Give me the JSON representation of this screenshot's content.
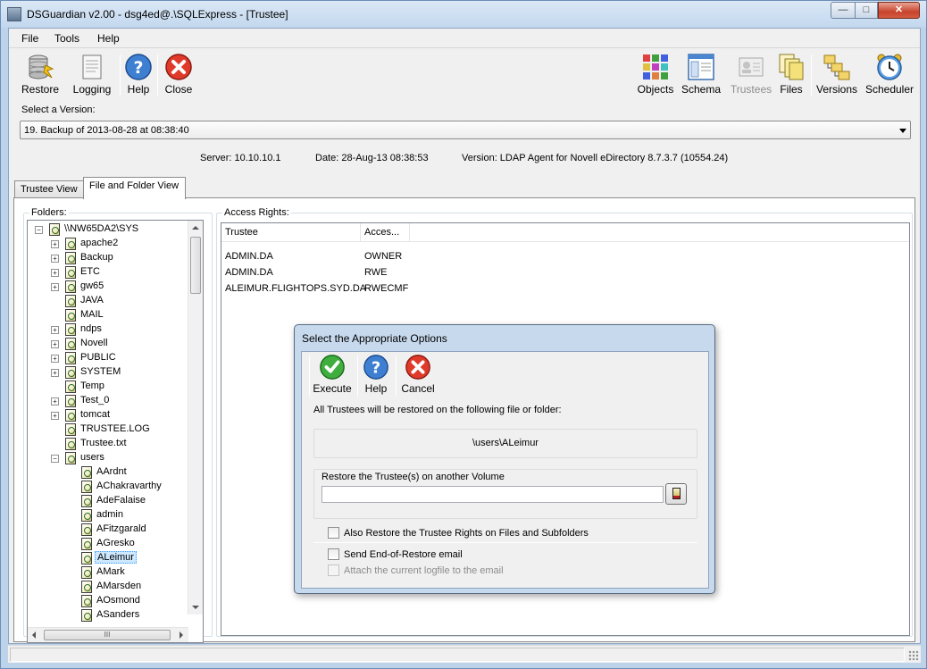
{
  "window": {
    "title": "DSGuardian v2.00 - dsg4ed@.\\SQLExpress - [Trustee]"
  },
  "menu": {
    "file": "File",
    "tools": "Tools",
    "help": "Help"
  },
  "toolbar": {
    "restore": "Restore",
    "logging": "Logging",
    "help": "Help",
    "close": "Close",
    "objects": "Objects",
    "schema": "Schema",
    "trustees": "Trustees",
    "files": "Files",
    "versions": "Versions",
    "scheduler": "Scheduler"
  },
  "version": {
    "label": "Select a Version:",
    "selected": "19. Backup of 2013-08-28 at 08:38:40"
  },
  "info": {
    "server": "Server: 10.10.10.1",
    "date": "Date: 28-Aug-13 08:38:53",
    "version": "Version: LDAP Agent for Novell eDirectory 8.7.3.7 (10554.24)"
  },
  "tabs": [
    {
      "label": "Trustee View",
      "active": false
    },
    {
      "label": "File and Folder View",
      "active": true
    }
  ],
  "folders": {
    "title": "Folders:",
    "root": "\\\\NW65DA2\\SYS",
    "items": [
      {
        "label": "apache2",
        "expandable": true
      },
      {
        "label": "Backup",
        "expandable": true
      },
      {
        "label": "ETC",
        "expandable": true
      },
      {
        "label": "gw65",
        "expandable": true
      },
      {
        "label": "JAVA",
        "expandable": false
      },
      {
        "label": "MAIL",
        "expandable": false
      },
      {
        "label": "ndps",
        "expandable": true
      },
      {
        "label": "Novell",
        "expandable": true
      },
      {
        "label": "PUBLIC",
        "expandable": true
      },
      {
        "label": "SYSTEM",
        "expandable": true
      },
      {
        "label": "Temp",
        "expandable": false
      },
      {
        "label": "Test_0",
        "expandable": true
      },
      {
        "label": "tomcat",
        "expandable": true
      },
      {
        "label": "TRUSTEE.LOG",
        "expandable": false
      },
      {
        "label": "Trustee.txt",
        "expandable": false
      },
      {
        "label": "users",
        "expandable": true,
        "expanded": true
      }
    ],
    "users": [
      "AArdnt",
      "AChakravarthy",
      "AdeFalaise",
      "admin",
      "AFitzgarald",
      "AGresko",
      "ALeimur",
      "AMark",
      "AMarsden",
      "AOsmond",
      "ASanders"
    ],
    "selected": "ALeimur"
  },
  "access": {
    "title": "Access Rights:",
    "columns": [
      "Trustee",
      "Acces..."
    ],
    "rows": [
      [
        "ADMIN.DA",
        "OWNER"
      ],
      [
        "ADMIN.DA",
        "RWE"
      ],
      [
        "ALEIMUR.FLIGHTOPS.SYD.DA",
        "RWECMF"
      ]
    ]
  },
  "dialog": {
    "title": "Select the Appropriate Options",
    "execute": "Execute",
    "help": "Help",
    "cancel": "Cancel",
    "info": "All Trustees will be restored on the following file or folder:",
    "path": "\\users\\ALeimur",
    "volume_group": "Restore the Trustee(s) on another Volume",
    "volume_value": "",
    "also_restore": "Also Restore the Trustee Rights on Files and Subfolders",
    "send_email": "Send End-of-Restore email",
    "attach_log": "Attach the current logfile to the email"
  },
  "scroll": {
    "hthumb": "III"
  },
  "colors": {
    "title_bar": "#c2d7ee",
    "selection": "#cde8ff",
    "close_button": "#c7432c"
  }
}
